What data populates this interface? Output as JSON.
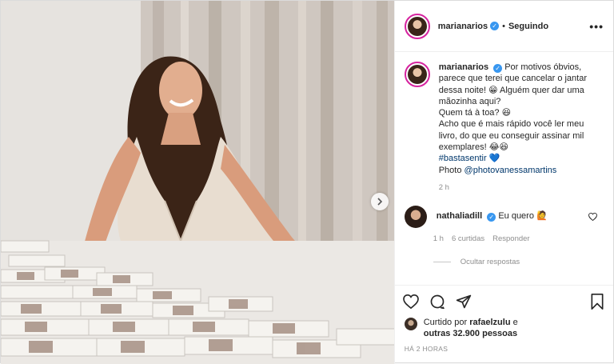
{
  "post": {
    "username": "marianarios",
    "follow_dot": "•",
    "follow_status": "Seguindo",
    "more_label": "•••",
    "caption": {
      "username": "marianarios",
      "line1": "Por motivos óbvios, parece que terei que cancelar o jantar dessa noite! 😁 Alguém quer dar uma mãozinha aqui?",
      "line2": "Quem tá à toa? 😆",
      "line3": "Acho que é mais rápido você ler meu livro, do que eu conseguir assinar mil exemplares! 😂😆",
      "hashtag": "#bastasentir",
      "heart": "💙",
      "photo_prefix": "Photo",
      "photo_credit": "@photovanessamartins",
      "age": "2 h"
    },
    "comment": {
      "username": "nathaliadill",
      "text": "Eu quero 🙋",
      "age": "1 h",
      "likes": "6 curtidas",
      "reply": "Responder",
      "hide_replies": "Ocultar respostas"
    },
    "liked_by": {
      "prefix": "Curtido por",
      "user": "rafaelzulu",
      "suffix": "e",
      "others": "outras 32.900 pessoas"
    },
    "timestamp": "HÁ 2 HORAS"
  },
  "icons": [
    "verified-badge-icon",
    "more-options-icon",
    "chevron-right-icon",
    "heart-icon",
    "comment-icon",
    "share-icon",
    "bookmark-icon"
  ],
  "colors": {
    "verified": "#3897f0",
    "link": "#00376b",
    "muted": "#8e8e8e",
    "story_ring": "#d6249f"
  }
}
